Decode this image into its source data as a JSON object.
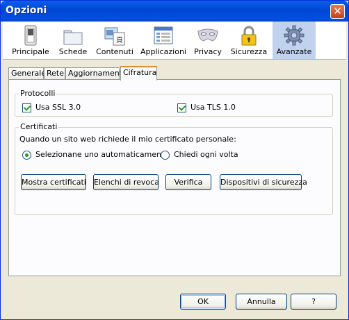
{
  "window": {
    "title": "Opzioni",
    "close_glyph": "✕"
  },
  "toolbar": {
    "items": [
      {
        "label": "Principale",
        "icon": "switch-icon"
      },
      {
        "label": "Schede",
        "icon": "folder-tabs-icon"
      },
      {
        "label": "Contenuti",
        "icon": "content-icon"
      },
      {
        "label": "Applicazioni",
        "icon": "applications-icon"
      },
      {
        "label": "Privacy",
        "icon": "mask-icon"
      },
      {
        "label": "Sicurezza",
        "icon": "padlock-icon"
      },
      {
        "label": "Avanzate",
        "icon": "gear-icon"
      }
    ],
    "selected": "Avanzate"
  },
  "tabs": {
    "items": [
      "Generale",
      "Rete",
      "Aggiornamenti",
      "Cifratura"
    ],
    "active": "Cifratura"
  },
  "protocolli": {
    "title": "Protocolli",
    "ssl_label": "Usa SSL 3.0",
    "ssl_checked": true,
    "tls_label": "Usa TLS 1.0",
    "tls_checked": true
  },
  "certificati": {
    "title": "Certificati",
    "question": "Quando un sito web richiede il mio certificato personale:",
    "option_auto": "Selezionane uno automaticamente",
    "option_ask": "Chiedi ogni volta",
    "selected_option": "auto",
    "buttons": {
      "mostra": "Mostra certificati",
      "elenchi": "Elenchi di revoca",
      "verifica": "Verifica",
      "dispositivi": "Dispositivi di sicurezza"
    }
  },
  "footer": {
    "ok": "OK",
    "annulla": "Annulla",
    "help": "?"
  }
}
